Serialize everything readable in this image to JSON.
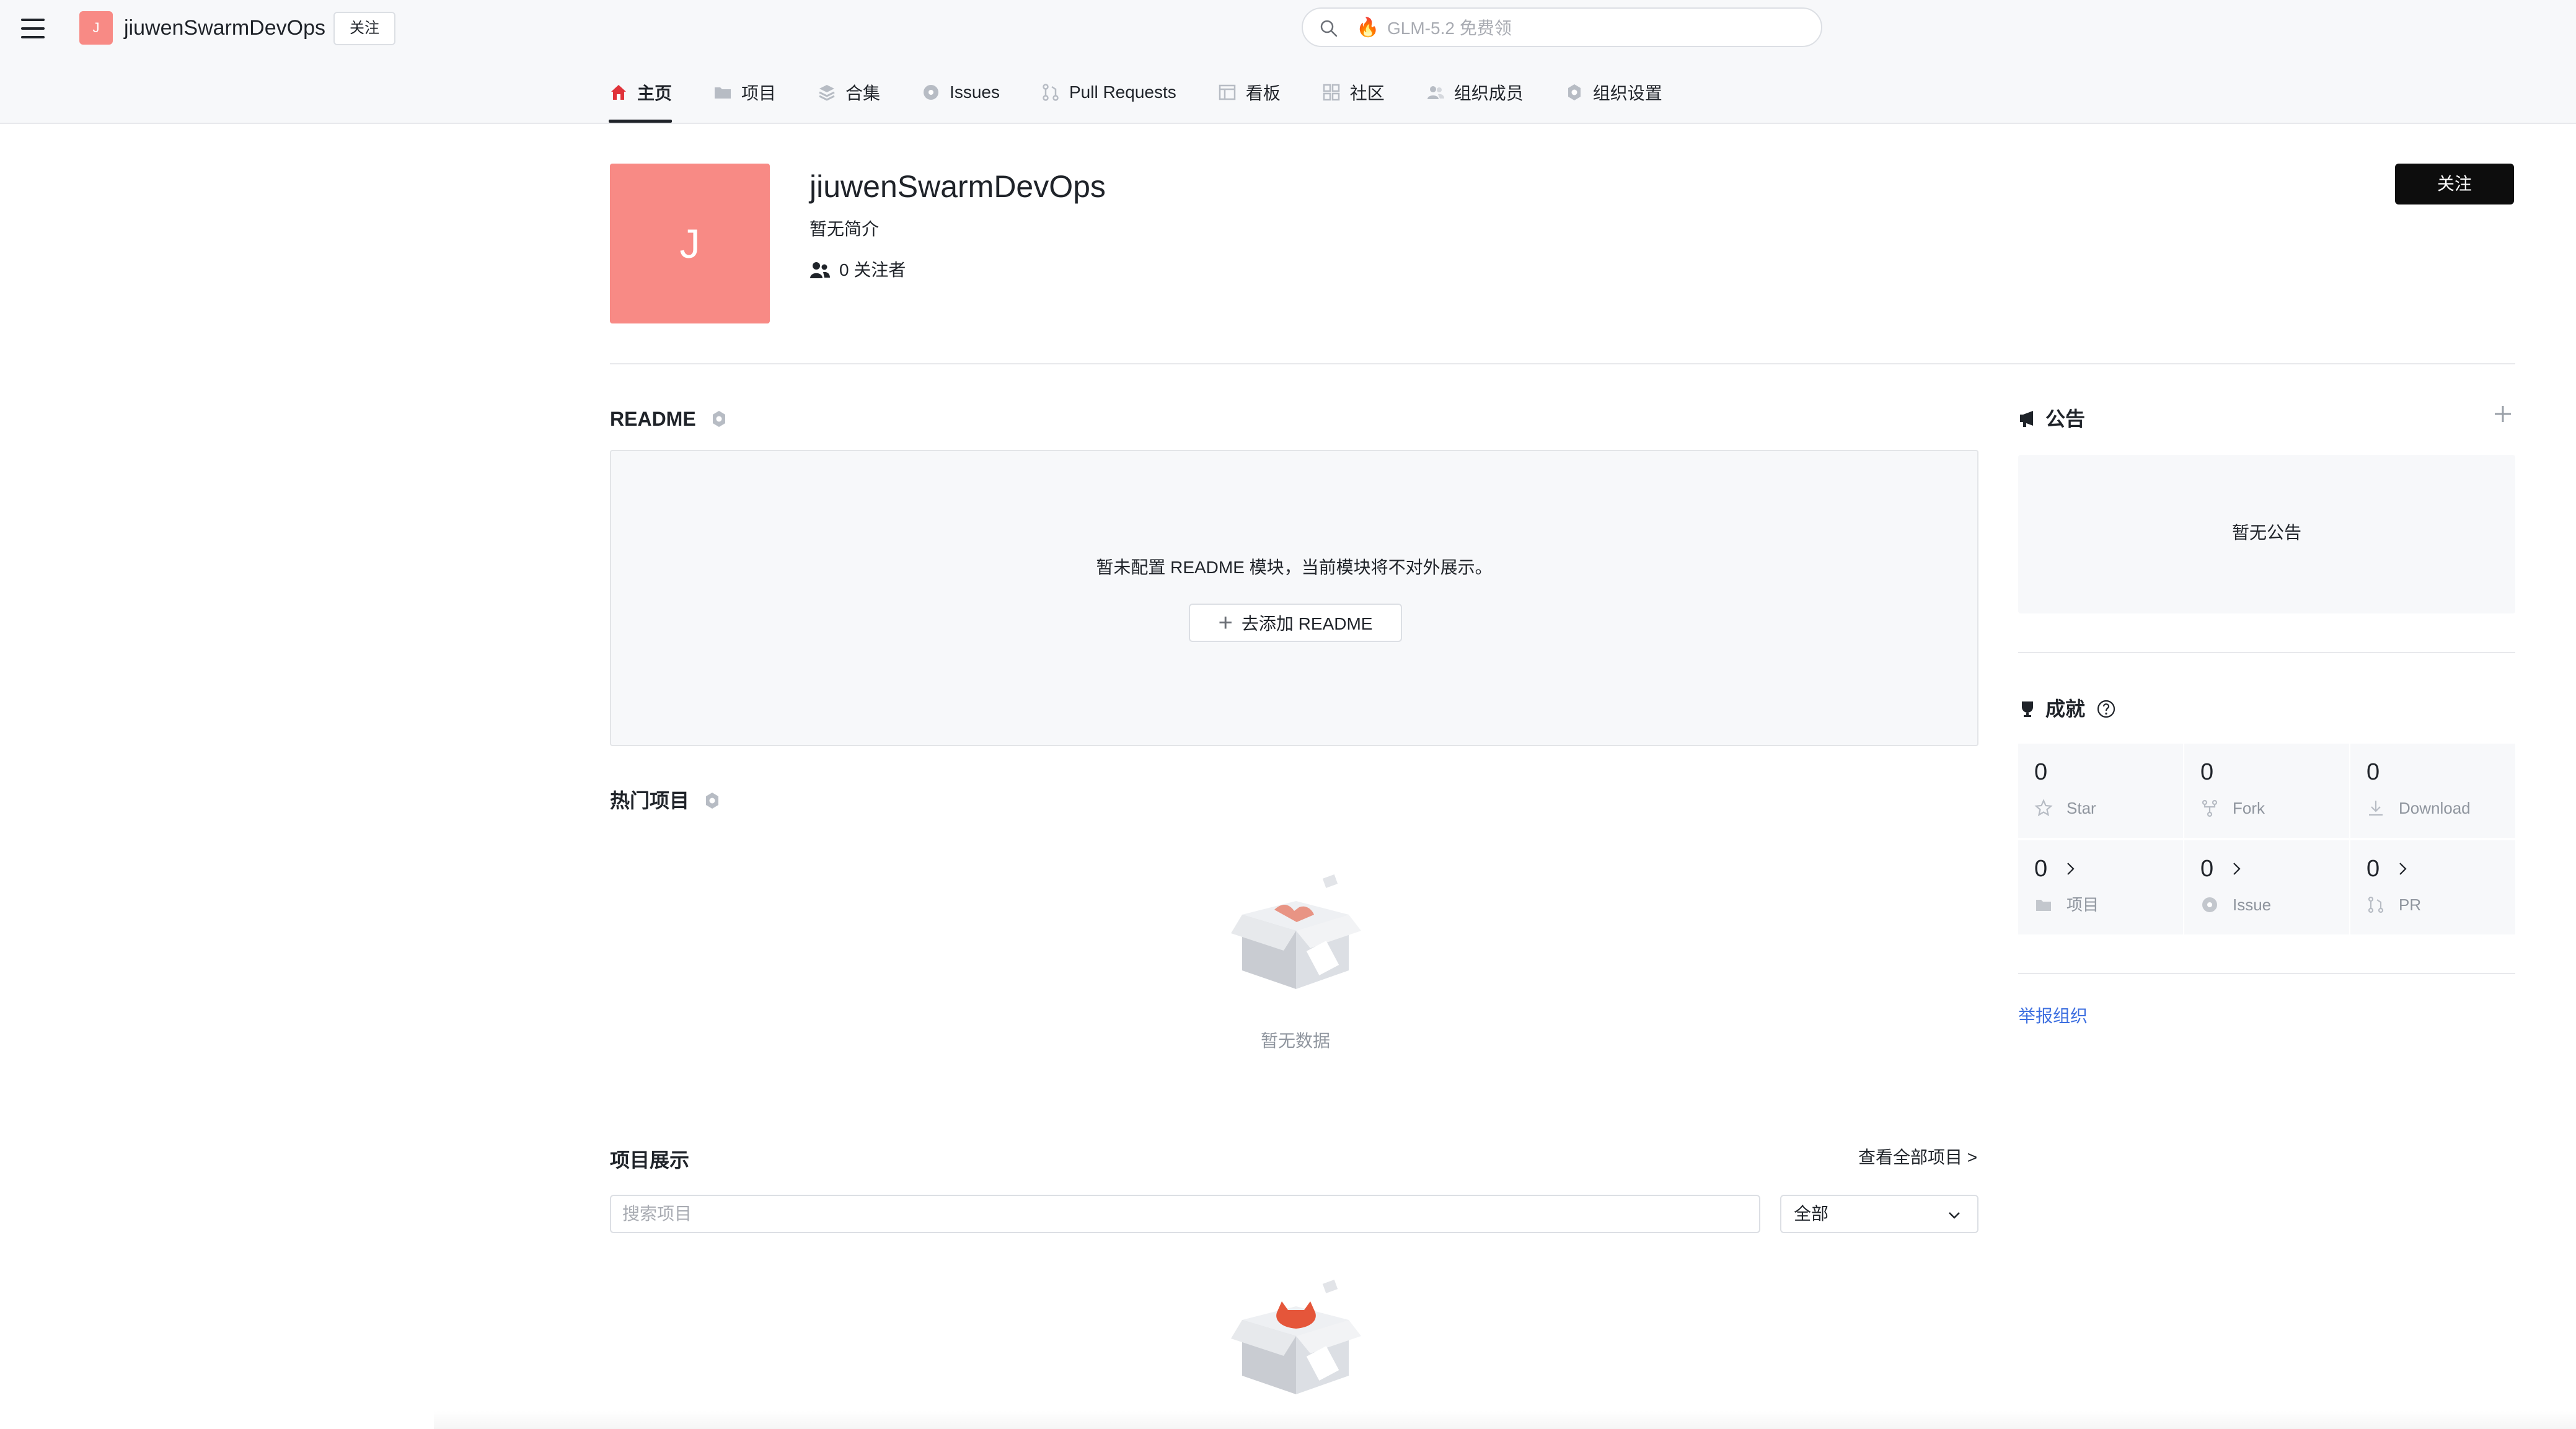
{
  "topbar": {
    "org_avatar_letter": "J",
    "org_name": "jiuwenSwarmDevOps",
    "follow_label": "关注",
    "search_placeholder": "GLM-5.2 免费领",
    "search_badge_icon": "fire-icon"
  },
  "nav": {
    "items": [
      {
        "label": "主页",
        "icon": "home-icon",
        "active": true
      },
      {
        "label": "项目",
        "icon": "folder-icon"
      },
      {
        "label": "合集",
        "icon": "layers-icon"
      },
      {
        "label": "Issues",
        "icon": "issue-icon"
      },
      {
        "label": "Pull Requests",
        "icon": "pull-request-icon"
      },
      {
        "label": "看板",
        "icon": "board-icon"
      },
      {
        "label": "社区",
        "icon": "community-icon"
      },
      {
        "label": "组织成员",
        "icon": "members-icon"
      },
      {
        "label": "组织设置",
        "icon": "settings-icon"
      }
    ]
  },
  "profile": {
    "avatar_letter": "J",
    "name": "jiuwenSwarmDevOps",
    "description": "暂无简介",
    "followers": "0 关注者",
    "follow_label": "关注"
  },
  "readme": {
    "title": "README",
    "message": "暂未配置 README 模块，当前模块将不对外展示。",
    "add_label": "去添加 README"
  },
  "hot_projects": {
    "title": "热门项目",
    "empty_text": "暂无数据"
  },
  "showcase": {
    "title": "项目展示",
    "view_all": "查看全部项目 >",
    "search_placeholder": "搜索项目",
    "filter_value": "全部"
  },
  "announcement": {
    "title": "公告",
    "empty_text": "暂无公告"
  },
  "achievements": {
    "title": "成就",
    "stats": [
      {
        "value": "0",
        "label": "Star",
        "icon": "star-icon",
        "arrow": false
      },
      {
        "value": "0",
        "label": "Fork",
        "icon": "fork-icon",
        "arrow": false
      },
      {
        "value": "0",
        "label": "Download",
        "icon": "download-icon",
        "arrow": false
      },
      {
        "value": "0",
        "label": "项目",
        "icon": "folder-icon",
        "arrow": true
      },
      {
        "value": "0",
        "label": "Issue",
        "icon": "issue-icon",
        "arrow": true
      },
      {
        "value": "0",
        "label": "PR",
        "icon": "pull-request-icon",
        "arrow": true
      }
    ]
  },
  "report_label": "举报组织",
  "colors": {
    "avatar": "#f88a85",
    "accent_link": "#3d6fe0",
    "primary_button": "#0d0d0d"
  }
}
